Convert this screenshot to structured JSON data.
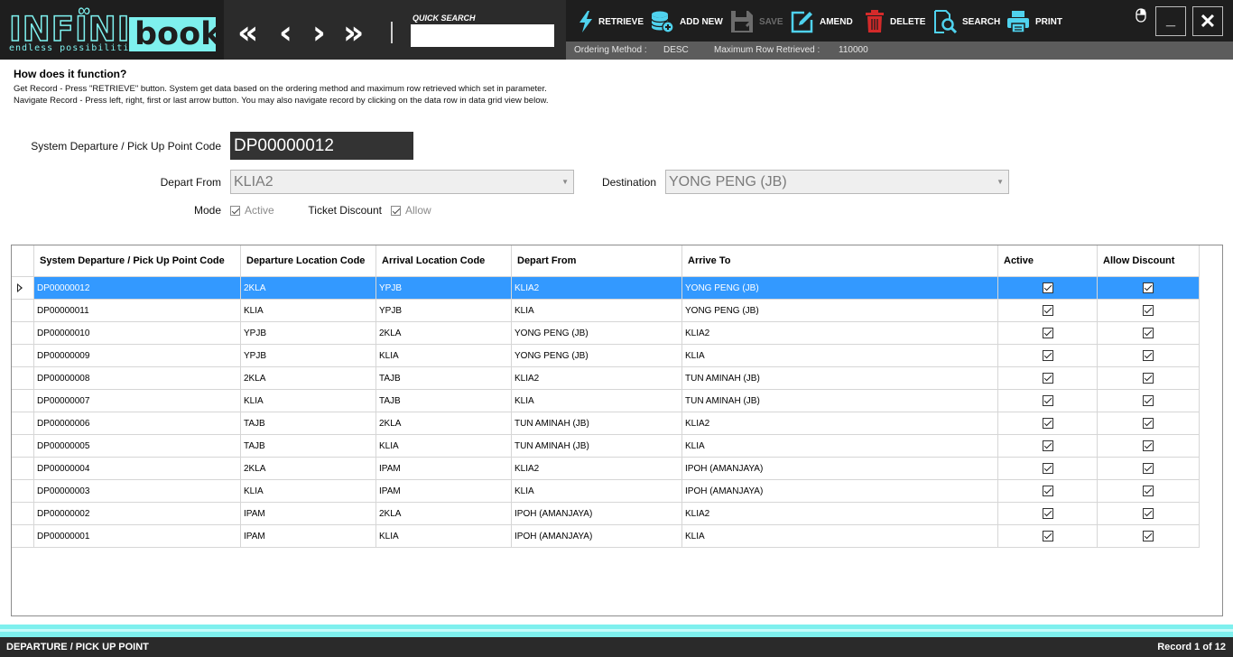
{
  "app": {
    "logo_main": "INFINI",
    "logo_book": "book",
    "logo_tagline": "endless possibilities"
  },
  "nav": {
    "first": "«",
    "prev": "‹",
    "next": "›",
    "last": "»"
  },
  "quick_search": {
    "label": "QUICK SEARCH",
    "value": "",
    "placeholder": ""
  },
  "toolbar": {
    "retrieve": "RETRIEVE",
    "add_new": "ADD NEW",
    "save": "SAVE",
    "amend": "AMEND",
    "delete": "DELETE",
    "search": "SEARCH",
    "print": "PRINT"
  },
  "infobar": {
    "ordering_label": "Ordering Method :",
    "ordering_value": "DESC",
    "max_rows_label": "Maximum Row Retrieved :",
    "max_rows_value": "110000"
  },
  "window": {
    "minimize": "_",
    "close": "✕"
  },
  "help": {
    "title": "How does it function?",
    "line1": "Get Record - Press \"RETRIEVE\" button. System get data based on the ordering method and maximum row retrieved which set in parameter.",
    "line2": "Navigate Record - Press left, right, first or last arrow button. You may also navigate record by clicking on the data row in data grid view below."
  },
  "form": {
    "code_label": "System Departure / Pick Up Point Code",
    "code_value": "DP00000012",
    "depart_label": "Depart From",
    "depart_value": "KLIA2",
    "destination_label": "Destination",
    "destination_value": "YONG PENG (JB)",
    "mode_label": "Mode",
    "mode_option": "Active",
    "mode_checked": true,
    "discount_label": "Ticket Discount",
    "discount_option": "Allow",
    "discount_checked": true
  },
  "grid": {
    "columns": [
      "System Departure / Pick Up Point Code",
      "Departure Location Code",
      "Arrival Location Code",
      "Depart From",
      "Arrive To",
      "Active",
      "Allow Discount"
    ],
    "selected_index": 0,
    "rows": [
      {
        "code": "DP00000012",
        "dep": "2KLA",
        "arr": "YPJB",
        "from": "KLIA2",
        "to": "YONG PENG (JB)",
        "active": true,
        "discount": true
      },
      {
        "code": "DP00000011",
        "dep": "KLIA",
        "arr": "YPJB",
        "from": "KLIA",
        "to": "YONG PENG (JB)",
        "active": true,
        "discount": true
      },
      {
        "code": "DP00000010",
        "dep": "YPJB",
        "arr": "2KLA",
        "from": "YONG PENG (JB)",
        "to": "KLIA2",
        "active": true,
        "discount": true
      },
      {
        "code": "DP00000009",
        "dep": "YPJB",
        "arr": "KLIA",
        "from": "YONG PENG (JB)",
        "to": "KLIA",
        "active": true,
        "discount": true
      },
      {
        "code": "DP00000008",
        "dep": "2KLA",
        "arr": "TAJB",
        "from": "KLIA2",
        "to": "TUN AMINAH (JB)",
        "active": true,
        "discount": true
      },
      {
        "code": "DP00000007",
        "dep": "KLIA",
        "arr": "TAJB",
        "from": "KLIA",
        "to": "TUN AMINAH (JB)",
        "active": true,
        "discount": true
      },
      {
        "code": "DP00000006",
        "dep": "TAJB",
        "arr": "2KLA",
        "from": "TUN AMINAH (JB)",
        "to": "KLIA2",
        "active": true,
        "discount": true
      },
      {
        "code": "DP00000005",
        "dep": "TAJB",
        "arr": "KLIA",
        "from": "TUN AMINAH (JB)",
        "to": "KLIA",
        "active": true,
        "discount": true
      },
      {
        "code": "DP00000004",
        "dep": "2KLA",
        "arr": "IPAM",
        "from": "KLIA2",
        "to": "IPOH (AMANJAYA)",
        "active": true,
        "discount": true
      },
      {
        "code": "DP00000003",
        "dep": "KLIA",
        "arr": "IPAM",
        "from": "KLIA",
        "to": "IPOH (AMANJAYA)",
        "active": true,
        "discount": true
      },
      {
        "code": "DP00000002",
        "dep": "IPAM",
        "arr": "2KLA",
        "from": "IPOH (AMANJAYA)",
        "to": "KLIA2",
        "active": true,
        "discount": true
      },
      {
        "code": "DP00000001",
        "dep": "IPAM",
        "arr": "KLIA",
        "from": "IPOH (AMANJAYA)",
        "to": "KLIA",
        "active": true,
        "discount": true
      }
    ]
  },
  "status": {
    "module": "DEPARTURE / PICK UP POINT",
    "record": "Record 1 of 12"
  },
  "colors": {
    "accent": "#7ef0ee",
    "header_bg": "#2b2b2b",
    "selected_row": "#3399ff",
    "delete_icon": "#d42a2a",
    "icon_blue": "#4fd2ee"
  }
}
